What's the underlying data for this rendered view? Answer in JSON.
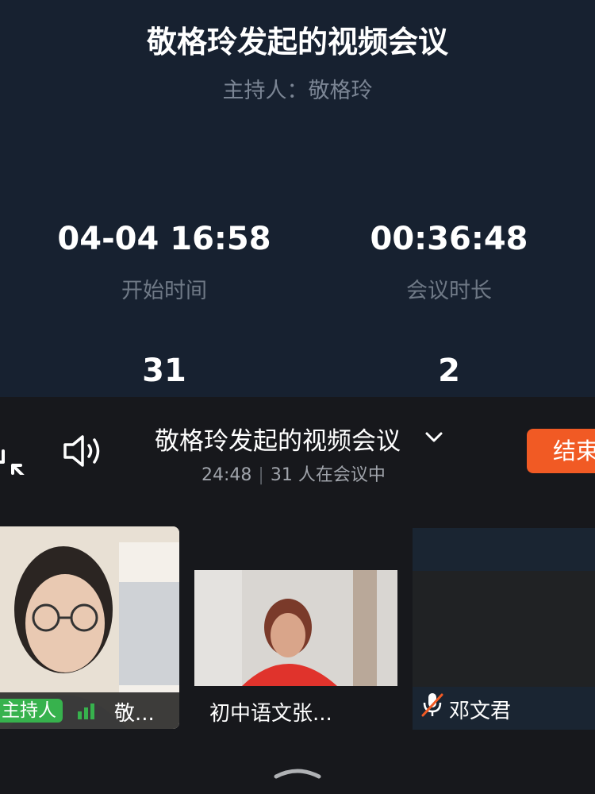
{
  "summary": {
    "title": "敬格玲发起的视频会议",
    "host": "主持人：敬格玲",
    "stats": [
      {
        "value": "04-04 16:58",
        "label": "开始时间"
      },
      {
        "value": "00:36:48",
        "label": "会议时长"
      },
      {
        "value": "31",
        "label": ""
      },
      {
        "value": "2",
        "label": ""
      }
    ]
  },
  "meeting": {
    "title": "敬格玲发起的视频会议",
    "elapsed": "24:48",
    "participants": "31 人在会议中",
    "end_label": "结束",
    "icons": [
      "exit-fullscreen-icon",
      "speaker-icon",
      "chevron-down-icon",
      "drag-handle-icon"
    ]
  },
  "tiles": [
    {
      "badge": "主持人",
      "name": "敬...",
      "icon": "signal-icon"
    },
    {
      "name": "初中语文张..."
    },
    {
      "name": "邓文君",
      "icon": "mic-off-icon"
    }
  ],
  "colors": {
    "summary_bg": "#172130",
    "meeting_bg": "#17181c",
    "end_button": "#f15a24",
    "host_badge": "#37b24d"
  }
}
